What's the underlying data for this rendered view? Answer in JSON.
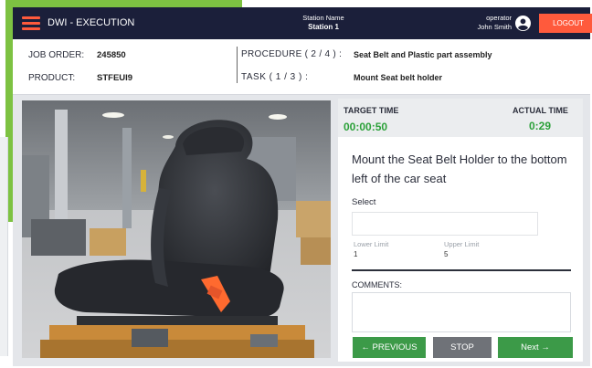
{
  "header": {
    "app_title": "DWI - EXECUTION",
    "station_label": "Station Name",
    "station_value": "Station 1",
    "operator_label": "operator",
    "operator_name": "John Smith",
    "logout_label": "LOGOUT",
    "accent_color": "#ff5a3c",
    "bar_color": "#1b1f3a"
  },
  "info": {
    "job_order_label": "JOB ORDER:",
    "job_order_value": "245850",
    "product_label": "PRODUCT:",
    "product_value": "STFEUI9",
    "procedure_label": "PROCEDURE ( 2 / 4 ) :",
    "procedure_value": "Seat Belt and Plastic part assembly",
    "task_label": "TASK ( 1 / 3 ) :",
    "task_value": "Mount Seat belt holder"
  },
  "timing": {
    "target_label": "TARGET TIME",
    "target_value": "00:00:50",
    "actual_label": "ACTUAL TIME",
    "actual_value": "0:29",
    "value_color": "#2ca13a"
  },
  "step": {
    "instruction": "Mount the Seat Belt Holder to the bottom left of the car seat",
    "select_label": "Select",
    "lower_limit_label": "Lower Limit",
    "lower_limit_value": "1",
    "upper_limit_label": "Upper Limit",
    "upper_limit_value": "5",
    "comments_label": "COMMENTS:"
  },
  "actions": {
    "previous_label": "← PREVIOUS",
    "stop_label": "STOP",
    "next_label": "Next →",
    "primary_color": "#3c9a48",
    "stop_color": "#6f7278"
  },
  "icons": {
    "menu": "hamburger-menu-icon",
    "user": "user-avatar-icon",
    "photo": "car-seat-photo"
  }
}
